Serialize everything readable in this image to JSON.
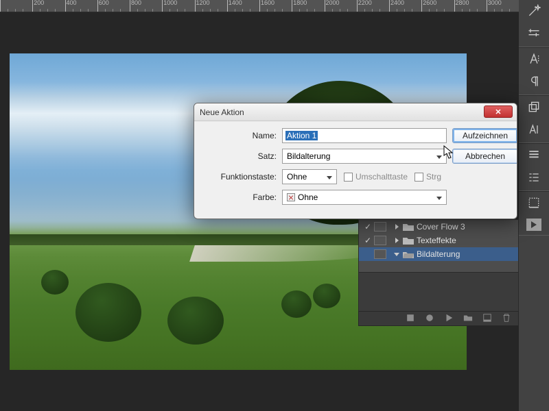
{
  "ruler": {
    "marks": [
      "",
      "200",
      "400",
      "600",
      "800",
      "1000",
      "1200",
      "1400",
      "1600",
      "1800",
      "2000",
      "2200",
      "2400",
      "2600",
      "2800",
      "3000"
    ]
  },
  "dialog": {
    "title": "Neue Aktion",
    "labels": {
      "name": "Name:",
      "set": "Satz:",
      "fkey": "Funktionstaste:",
      "color": "Farbe:"
    },
    "name_value": "Aktion 1",
    "set_value": "Bildalterung",
    "fkey_value": "Ohne",
    "shift_label": "Umschalttaste",
    "ctrl_label": "Strg",
    "color_value": "Ohne",
    "btn_record": "Aufzeichnen",
    "btn_cancel": "Abbrechen"
  },
  "actions_panel": {
    "rows": [
      {
        "checked": true,
        "expand": "right",
        "label": "Cover Flow 3"
      },
      {
        "checked": true,
        "expand": "right",
        "label": "Texteffekte"
      },
      {
        "checked": false,
        "expand": "down",
        "label": "Bildalterung",
        "selected": true
      }
    ]
  },
  "rail": {
    "group1": [
      "wand-icon",
      "sliders-icon"
    ],
    "group2": [
      "char-A-icon",
      "paragraph-icon"
    ],
    "group3": [
      "stacked-squares-icon",
      "char-align-icon"
    ],
    "group4": [
      "list-icon",
      "properties-icon"
    ],
    "group5": [
      "dotted-square-icon",
      "play-icon"
    ]
  }
}
